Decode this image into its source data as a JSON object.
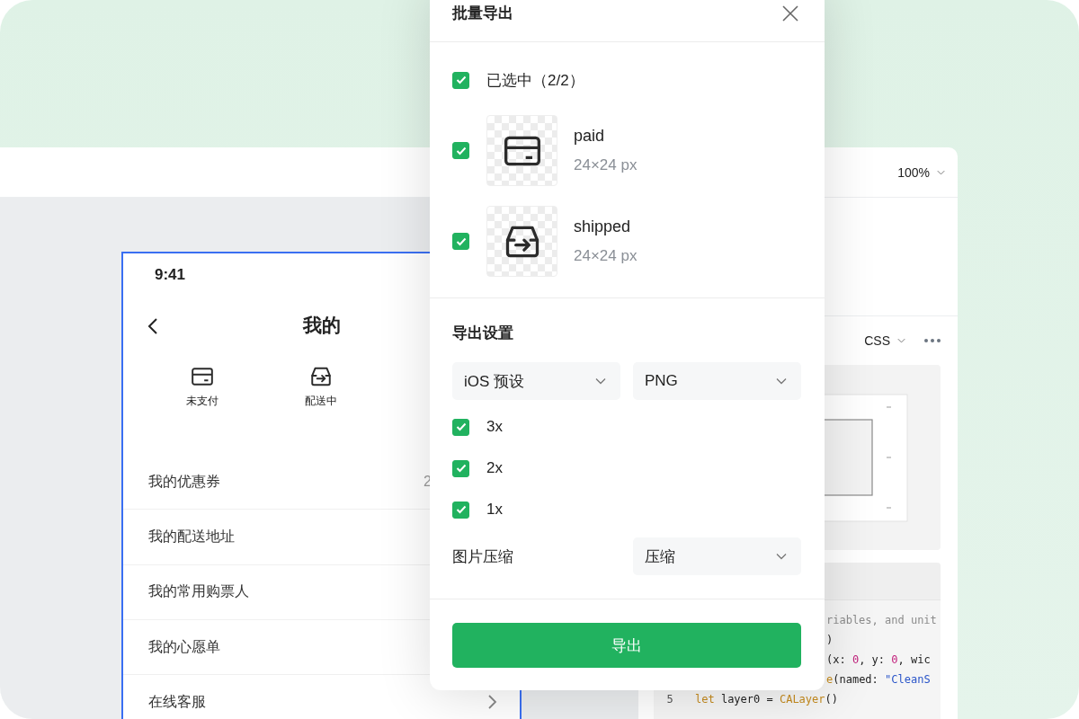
{
  "editor": {
    "zoom": "100%",
    "inspector": {
      "language": "CSS",
      "code_lines": [
        {
          "tokens": [
            {
              "kind": "comment",
              "text": "riables, and unit"
            }
          ]
        },
        {
          "tokens": [
            {
              "kind": "plain",
              "text": ")"
            }
          ]
        },
        {
          "tokens": [
            {
              "kind": "plain",
              "text": "(x: "
            },
            {
              "kind": "num",
              "text": "0"
            },
            {
              "kind": "plain",
              "text": ", y: "
            },
            {
              "kind": "num",
              "text": "0"
            },
            {
              "kind": "plain",
              "text": ", wic"
            }
          ]
        },
        {
          "tokens": [
            {
              "kind": "func",
              "text": "e"
            },
            {
              "kind": "plain",
              "text": "(named: "
            },
            {
              "kind": "str",
              "text": "\"CleanS"
            }
          ]
        },
        {
          "number": "5",
          "tokens": [
            {
              "kind": "kw",
              "text": "let"
            },
            {
              "kind": "plain",
              "text": " layer0 = "
            },
            {
              "kind": "func",
              "text": "CALayer"
            },
            {
              "kind": "plain",
              "text": "()"
            }
          ]
        }
      ]
    }
  },
  "phone": {
    "time": "9:41",
    "title": "我的",
    "shortcuts": [
      {
        "label": "未支付",
        "kind": "card"
      },
      {
        "label": "配送中",
        "kind": "box"
      }
    ],
    "menu": [
      {
        "label": "我的优惠券",
        "value": "2"
      },
      {
        "label": "我的配送地址"
      },
      {
        "label": "我的常用购票人"
      },
      {
        "label": "我的心愿单"
      },
      {
        "label": "在线客服",
        "chevron": true
      }
    ]
  },
  "dialog": {
    "title": "批量导出",
    "select_all": {
      "label": "已选中（2/2）",
      "checked": true
    },
    "assets": [
      {
        "name": "paid",
        "size": "24×24 px",
        "kind": "card",
        "checked": true
      },
      {
        "name": "shipped",
        "size": "24×24 px",
        "kind": "box",
        "checked": true
      }
    ],
    "settings": {
      "heading": "导出设置",
      "preset": "iOS 预设",
      "format": "PNG",
      "scales": [
        {
          "label": "3x",
          "checked": true
        },
        {
          "label": "2x",
          "checked": true
        },
        {
          "label": "1x",
          "checked": true
        }
      ],
      "compression": {
        "label": "图片压缩",
        "value": "压缩"
      }
    },
    "export_button": "导出"
  }
}
